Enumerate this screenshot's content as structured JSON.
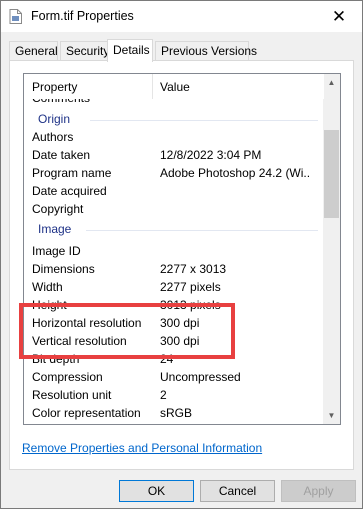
{
  "window": {
    "title": "Form.tif Properties",
    "close_glyph": "✕"
  },
  "tabs": [
    {
      "label": "General"
    },
    {
      "label": "Security"
    },
    {
      "label": "Details",
      "active": true
    },
    {
      "label": "Previous Versions"
    }
  ],
  "columns": {
    "property": "Property",
    "value": "Value"
  },
  "details": {
    "partial_top": "Comments",
    "group_origin": "Origin",
    "authors": {
      "property": "Authors",
      "value": ""
    },
    "date_taken": {
      "property": "Date taken",
      "value": "12/8/2022 3:04 PM"
    },
    "program_name": {
      "property": "Program name",
      "value": "Adobe Photoshop 24.2 (Wi..."
    },
    "date_acquired": {
      "property": "Date acquired",
      "value": ""
    },
    "copyright": {
      "property": "Copyright",
      "value": ""
    },
    "group_image": "Image",
    "image_id": {
      "property": "Image ID",
      "value": ""
    },
    "dimensions": {
      "property": "Dimensions",
      "value": "2277 x 3013"
    },
    "width": {
      "property": "Width",
      "value": "2277 pixels"
    },
    "height": {
      "property": "Height",
      "value": "3013 pixels"
    },
    "horizontal_resolution": {
      "property": "Horizontal resolution",
      "value": "300 dpi"
    },
    "vertical_resolution": {
      "property": "Vertical resolution",
      "value": "300 dpi"
    },
    "bit_depth": {
      "property": "Bit depth",
      "value": "24"
    },
    "compression": {
      "property": "Compression",
      "value": "Uncompressed"
    },
    "resolution_unit": {
      "property": "Resolution unit",
      "value": "2"
    },
    "color_representation": {
      "property": "Color representation",
      "value": "sRGB"
    }
  },
  "link": "Remove Properties and Personal Information",
  "buttons": {
    "ok": "OK",
    "cancel": "Cancel",
    "apply": "Apply"
  },
  "colors": {
    "highlight": "#e84040",
    "group_header": "#1e3287",
    "link": "#0066cc"
  },
  "icons": {
    "title": "tif-file-icon",
    "close": "close-icon"
  }
}
